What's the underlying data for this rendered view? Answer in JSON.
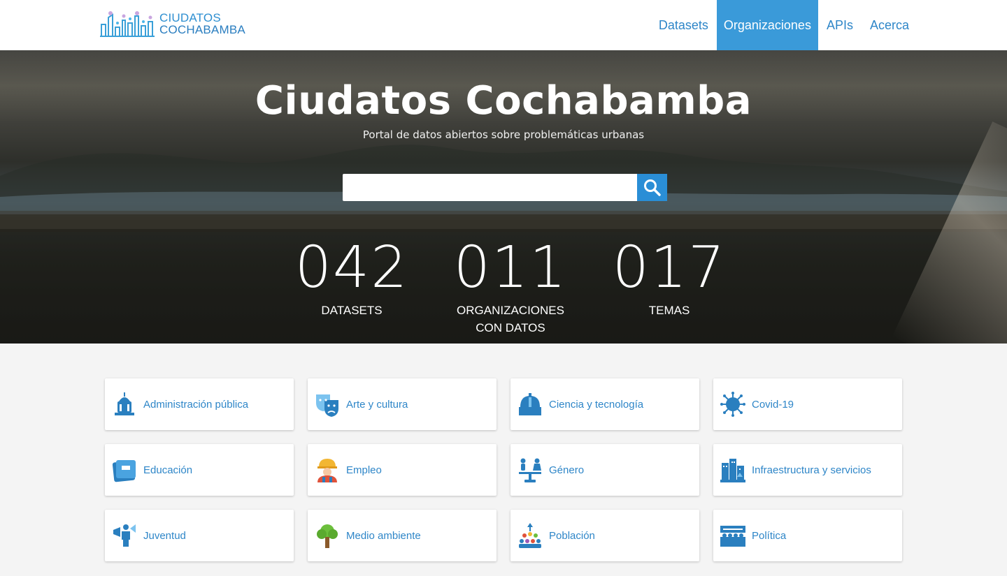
{
  "brand": {
    "line1": "CIUDATOS",
    "line2": "COCHABAMBA"
  },
  "nav": [
    {
      "label": "Datasets",
      "active": false
    },
    {
      "label": "Organizaciones",
      "active": true
    },
    {
      "label": "APIs",
      "active": false
    },
    {
      "label": "Acerca",
      "active": false
    }
  ],
  "hero": {
    "title": "Ciudatos Cochabamba",
    "subtitle": "Portal de datos abiertos sobre problemáticas urbanas",
    "search_value": "",
    "search_icon": "search-icon"
  },
  "stats": [
    {
      "value": "042",
      "label_line1": "DATASETS",
      "label_line2": ""
    },
    {
      "value": "011",
      "label_line1": "ORGANIZACIONES",
      "label_line2": "CON DATOS"
    },
    {
      "value": "017",
      "label_line1": "TEMAS",
      "label_line2": ""
    }
  ],
  "topics": [
    {
      "label": "Administración pública",
      "icon": "government-building-icon"
    },
    {
      "label": "Arte y cultura",
      "icon": "theater-masks-icon"
    },
    {
      "label": "Ciencia y tecnología",
      "icon": "observatory-icon"
    },
    {
      "label": "Covid-19",
      "icon": "virus-icon"
    },
    {
      "label": "Educación",
      "icon": "book-icon"
    },
    {
      "label": "Empleo",
      "icon": "worker-icon"
    },
    {
      "label": "Género",
      "icon": "gender-scale-icon"
    },
    {
      "label": "Infraestructura y servicios",
      "icon": "city-infrastructure-icon"
    },
    {
      "label": "Juventud",
      "icon": "youth-megaphone-icon"
    },
    {
      "label": "Medio ambiente",
      "icon": "tree-icon"
    },
    {
      "label": "Población",
      "icon": "population-group-icon"
    },
    {
      "label": "Política",
      "icon": "parliament-icon"
    }
  ],
  "colors": {
    "accent": "#3a9ad9",
    "link": "#2e86c8",
    "search_button": "#2a8ed6"
  }
}
